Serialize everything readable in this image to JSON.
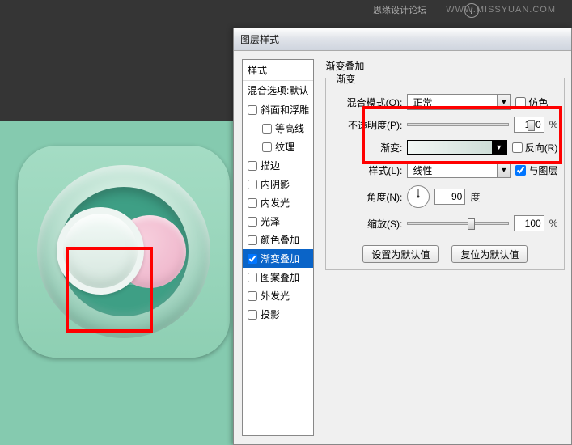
{
  "watermark": {
    "site": "WWW.MISSYUAN.COM",
    "zh": "思缘设计论坛"
  },
  "dialog": {
    "title": "图层样式"
  },
  "styles": {
    "header": "样式",
    "default_row": "混合选项:默认",
    "items": [
      {
        "label": "斜面和浮雕",
        "checked": false,
        "indent": false
      },
      {
        "label": "等高线",
        "checked": false,
        "indent": true
      },
      {
        "label": "纹理",
        "checked": false,
        "indent": true
      },
      {
        "label": "描边",
        "checked": false,
        "indent": false
      },
      {
        "label": "内阴影",
        "checked": false,
        "indent": false
      },
      {
        "label": "内发光",
        "checked": false,
        "indent": false
      },
      {
        "label": "光泽",
        "checked": false,
        "indent": false
      },
      {
        "label": "颜色叠加",
        "checked": false,
        "indent": false
      },
      {
        "label": "渐变叠加",
        "checked": true,
        "indent": false,
        "active": true
      },
      {
        "label": "图案叠加",
        "checked": false,
        "indent": false
      },
      {
        "label": "外发光",
        "checked": false,
        "indent": false
      },
      {
        "label": "投影",
        "checked": false,
        "indent": false
      }
    ]
  },
  "options": {
    "section": "渐变叠加",
    "group": "渐变",
    "blend_mode_label": "混合模式(O):",
    "blend_mode_value": "正常",
    "dither_label": "仿色",
    "opacity_label": "不透明度(P):",
    "opacity_value": "100",
    "opacity_suffix": "%",
    "gradient_label": "渐变:",
    "reverse_label": "反向(R)",
    "style_label": "样式(L):",
    "style_value": "线性",
    "align_label": "与图层",
    "angle_label": "角度(N):",
    "angle_value": "90",
    "angle_suffix": "度",
    "scale_label": "缩放(S):",
    "scale_value": "100",
    "scale_suffix": "%",
    "btn_default": "设置为默认值",
    "btn_reset": "复位为默认值"
  }
}
